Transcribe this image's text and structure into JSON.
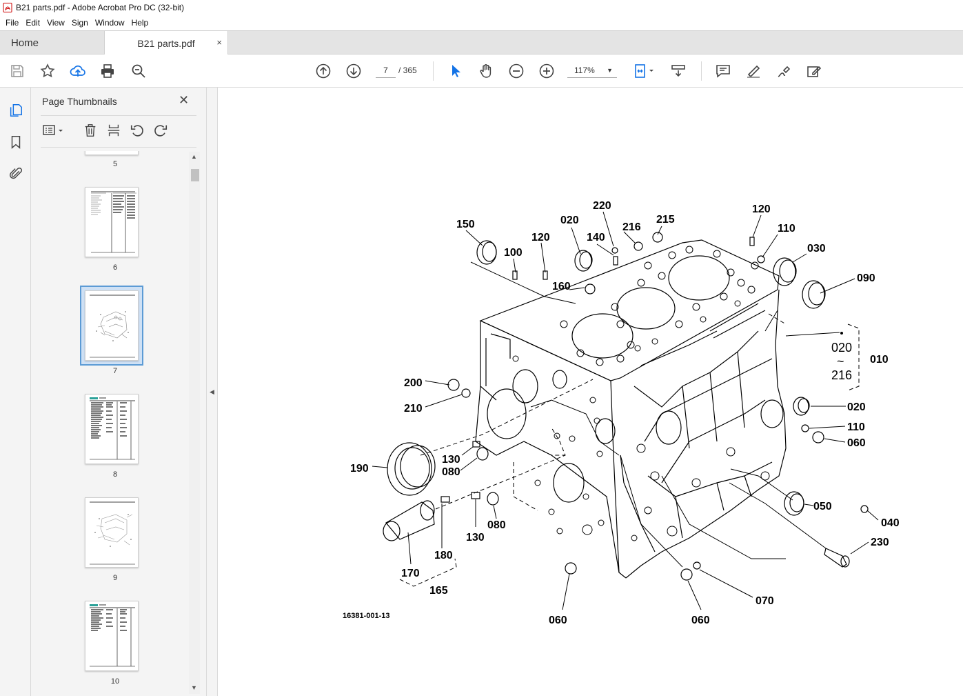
{
  "window": {
    "title": "B21 parts.pdf - Adobe Acrobat Pro DC (32-bit)"
  },
  "menu": [
    "File",
    "Edit",
    "View",
    "Sign",
    "Window",
    "Help"
  ],
  "tabs": {
    "home": "Home",
    "document": "B21 parts.pdf",
    "close_glyph": "×"
  },
  "toolbar": {
    "page_current": "7",
    "page_total": "/ 365",
    "zoom": "117%",
    "icons": [
      "save-icon",
      "bookmark-star-icon",
      "upload-cloud-icon",
      "print-icon",
      "zoom-search-icon",
      "prev-page-icon",
      "next-page-icon",
      "select-cursor-icon",
      "hand-icon",
      "zoom-out-icon",
      "zoom-in-icon",
      "fit-page-icon",
      "scroll-mode-icon",
      "comment-icon",
      "highlight-icon",
      "sign-icon",
      "fill-sign-icon"
    ]
  },
  "panel": {
    "title": "Page Thumbnails",
    "close_glyph": "✕",
    "thumbnails": [
      {
        "label": "5"
      },
      {
        "label": "6"
      },
      {
        "label": "7",
        "selected": true
      },
      {
        "label": "8"
      },
      {
        "label": "9"
      },
      {
        "label": "10"
      }
    ]
  },
  "diagram": {
    "drawing_number": "16381-001-13",
    "callouts": [
      "150",
      "100",
      "020",
      "120",
      "140",
      "220",
      "216",
      "215",
      "120",
      "110",
      "030",
      "090",
      "160",
      "010",
      "020",
      "216",
      "200",
      "210",
      "020",
      "110",
      "060",
      "190",
      "130",
      "080",
      "050",
      "040",
      "230",
      "170",
      "180",
      "130",
      "080",
      "165",
      "060",
      "060",
      "070"
    ]
  }
}
